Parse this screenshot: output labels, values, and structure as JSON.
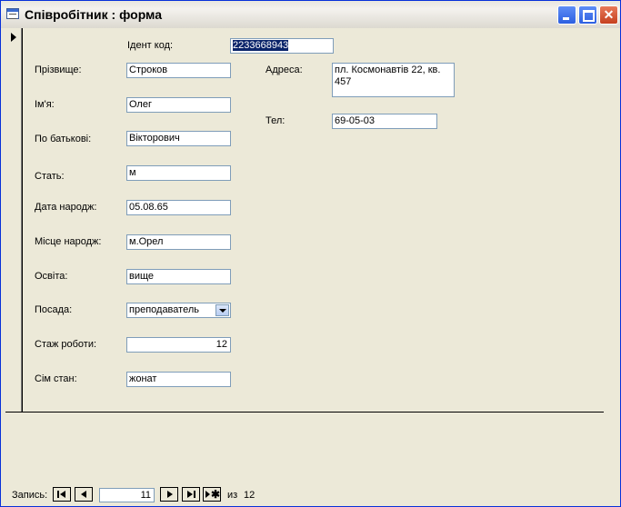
{
  "window": {
    "title": "Співробітник : форма"
  },
  "form": {
    "id_label": "Ідент код:",
    "id_value": "2233668943",
    "surname_label": "Прізвище:",
    "surname_value": "Строков",
    "name_label": "Ім'я:",
    "name_value": "Олег",
    "patronymic_label": "По батькові:",
    "patronymic_value": "Вікторович",
    "sex_label": "Стать:",
    "sex_value": "м",
    "birthdate_label": "Дата народж:",
    "birthdate_value": "05.08.65",
    "birthplace_label": "Місце народж:",
    "birthplace_value": "м.Орел",
    "education_label": "Освіта:",
    "education_value": "вище",
    "position_label": "Посада:",
    "position_value": "преподаватель",
    "experience_label": "Стаж роботи:",
    "experience_value": "12",
    "marital_label": "Сім стан:",
    "marital_value": "жонат",
    "address_label": "Адреса:",
    "address_value": "пл. Космонавтів 22, кв. 457",
    "phone_label": "Тел:",
    "phone_value": "69-05-03"
  },
  "navigation": {
    "label": "Запись:",
    "current": "11",
    "of_label": "из",
    "total": "12"
  }
}
